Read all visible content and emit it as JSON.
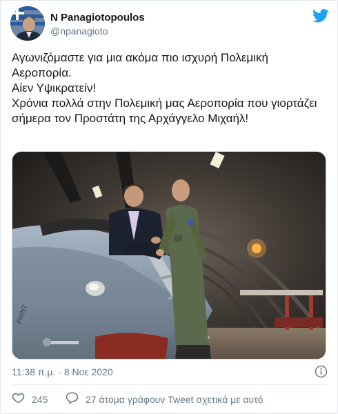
{
  "user": {
    "name": "N Panagiotopoulos",
    "handle": "@npanagioto"
  },
  "tweet": {
    "lines": [
      "Αγωνιζόμαστε για μια ακόμα πιο ισχυρή Πολεμική Αεροπορία.",
      "Αίεν Υψικρατείν!",
      "Χρόνια πολλά στην Πολεμική μας Αεροπορία που γιορτάζει σήμερα τον Προστάτη της Αρχάγγελο Μιχαήλ!"
    ],
    "timestamp": "11:38 π.μ. · 8 Νοε 2020"
  },
  "actions": {
    "like_count": "245",
    "reply_label": "27 άτομα γράφουν Tweet σχετικά με αυτό"
  },
  "colors": {
    "twitter_blue": "#1da1f2",
    "secondary_text": "#657786",
    "primary_text": "#14171a"
  },
  "icons": [
    "twitter-bird-icon",
    "info-icon",
    "heart-icon",
    "speech-bubble-icon"
  ]
}
